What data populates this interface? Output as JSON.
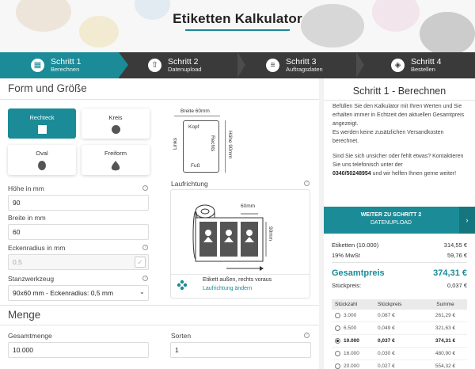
{
  "header": {
    "title": "Etiketten Kalkulator"
  },
  "steps": [
    {
      "title": "Schritt 1",
      "sub": "Berechnen",
      "icon": "calculator-icon"
    },
    {
      "title": "Schritt 2",
      "sub": "Datenupload",
      "icon": "upload-icon"
    },
    {
      "title": "Schritt 3",
      "sub": "Auftragsdaten",
      "icon": "document-icon"
    },
    {
      "title": "Schritt 4",
      "sub": "Bestellen",
      "icon": "box-icon"
    }
  ],
  "form": {
    "section_title": "Form und Größe",
    "shapes": [
      {
        "label": "Rechteck",
        "active": true
      },
      {
        "label": "Kreis",
        "active": false
      },
      {
        "label": "Oval",
        "active": false
      },
      {
        "label": "Freiform",
        "active": false
      }
    ],
    "fields": {
      "height_label": "Höhe in mm",
      "height_value": "90",
      "width_label": "Breite in mm",
      "width_value": "60",
      "radius_label": "Eckenradius in mm",
      "radius_value": "0,5",
      "tool_label": "Stanzwerkzeug",
      "tool_value": "90x60 mm - Eckenradius: 0,5 mm"
    },
    "label_diagram": {
      "width_text": "Breite 60mm",
      "top": "Kopf",
      "bottom": "Fuß",
      "left": "Links",
      "right": "Rechts",
      "height_text": "Höhe 90mm"
    },
    "run": {
      "label": "Laufrichtung",
      "width_text": "60mm",
      "height_text": "90mm",
      "footer_text": "Etikett außen, rechts voraus",
      "change_link": "Laufrichtung ändern"
    }
  },
  "quantity": {
    "section_title": "Menge",
    "total_label": "Gesamtmenge",
    "total_value": "10.000",
    "sorts_label": "Sorten",
    "sorts_value": "1"
  },
  "sidebar": {
    "title": "Schritt 1 - Berechnen",
    "info1": "Befüllen Sie den Kalkulator mit Ihren Werten und Sie erhalten immer in Echtzeit den aktuellen Gesamtpreis angezeigt.",
    "info2": "Es werden keine zusätzlichen Versandkosten berechnet.",
    "info3": "Sind Sie sich unsicher oder fehlt etwas? Kontaktieren Sie uns telefonisch unter der",
    "phone": "0340/50248954",
    "info4": " und wir helfen Ihnen gerne weiter!",
    "cta_line1": "WEITER ZU SCHRITT 2",
    "cta_line2": "DATENUPLOAD",
    "summary": {
      "labels_label": "Etiketten (10.000)",
      "labels_value": "314,55 €",
      "vat_label": "19% MwSt",
      "vat_value": "59,76 €",
      "total_label": "Gesamtpreis",
      "total_value": "374,31 €",
      "unit_label": "Stückpreis:",
      "unit_value": "0,037 €"
    },
    "table": {
      "headers": [
        "Stückzahl",
        "Stückpreis",
        "Summe"
      ],
      "rows": [
        {
          "qty": "3.000",
          "unit": "0,087 €",
          "sum": "261,29 €",
          "selected": false
        },
        {
          "qty": "6.500",
          "unit": "0,049 €",
          "sum": "321,63 €",
          "selected": false
        },
        {
          "qty": "10.000",
          "unit": "0,037 €",
          "sum": "374,31 €",
          "selected": true
        },
        {
          "qty": "16.000",
          "unit": "0,030 €",
          "sum": "480,90 €",
          "selected": false
        },
        {
          "qty": "20.000",
          "unit": "0,027 €",
          "sum": "554,32 €",
          "selected": false
        }
      ]
    }
  },
  "colors": {
    "accent": "#1a8b97",
    "steps_bg": "#3a3a3a",
    "panel_bg": "#ffffff",
    "page_bg": "#f2f2f2"
  }
}
